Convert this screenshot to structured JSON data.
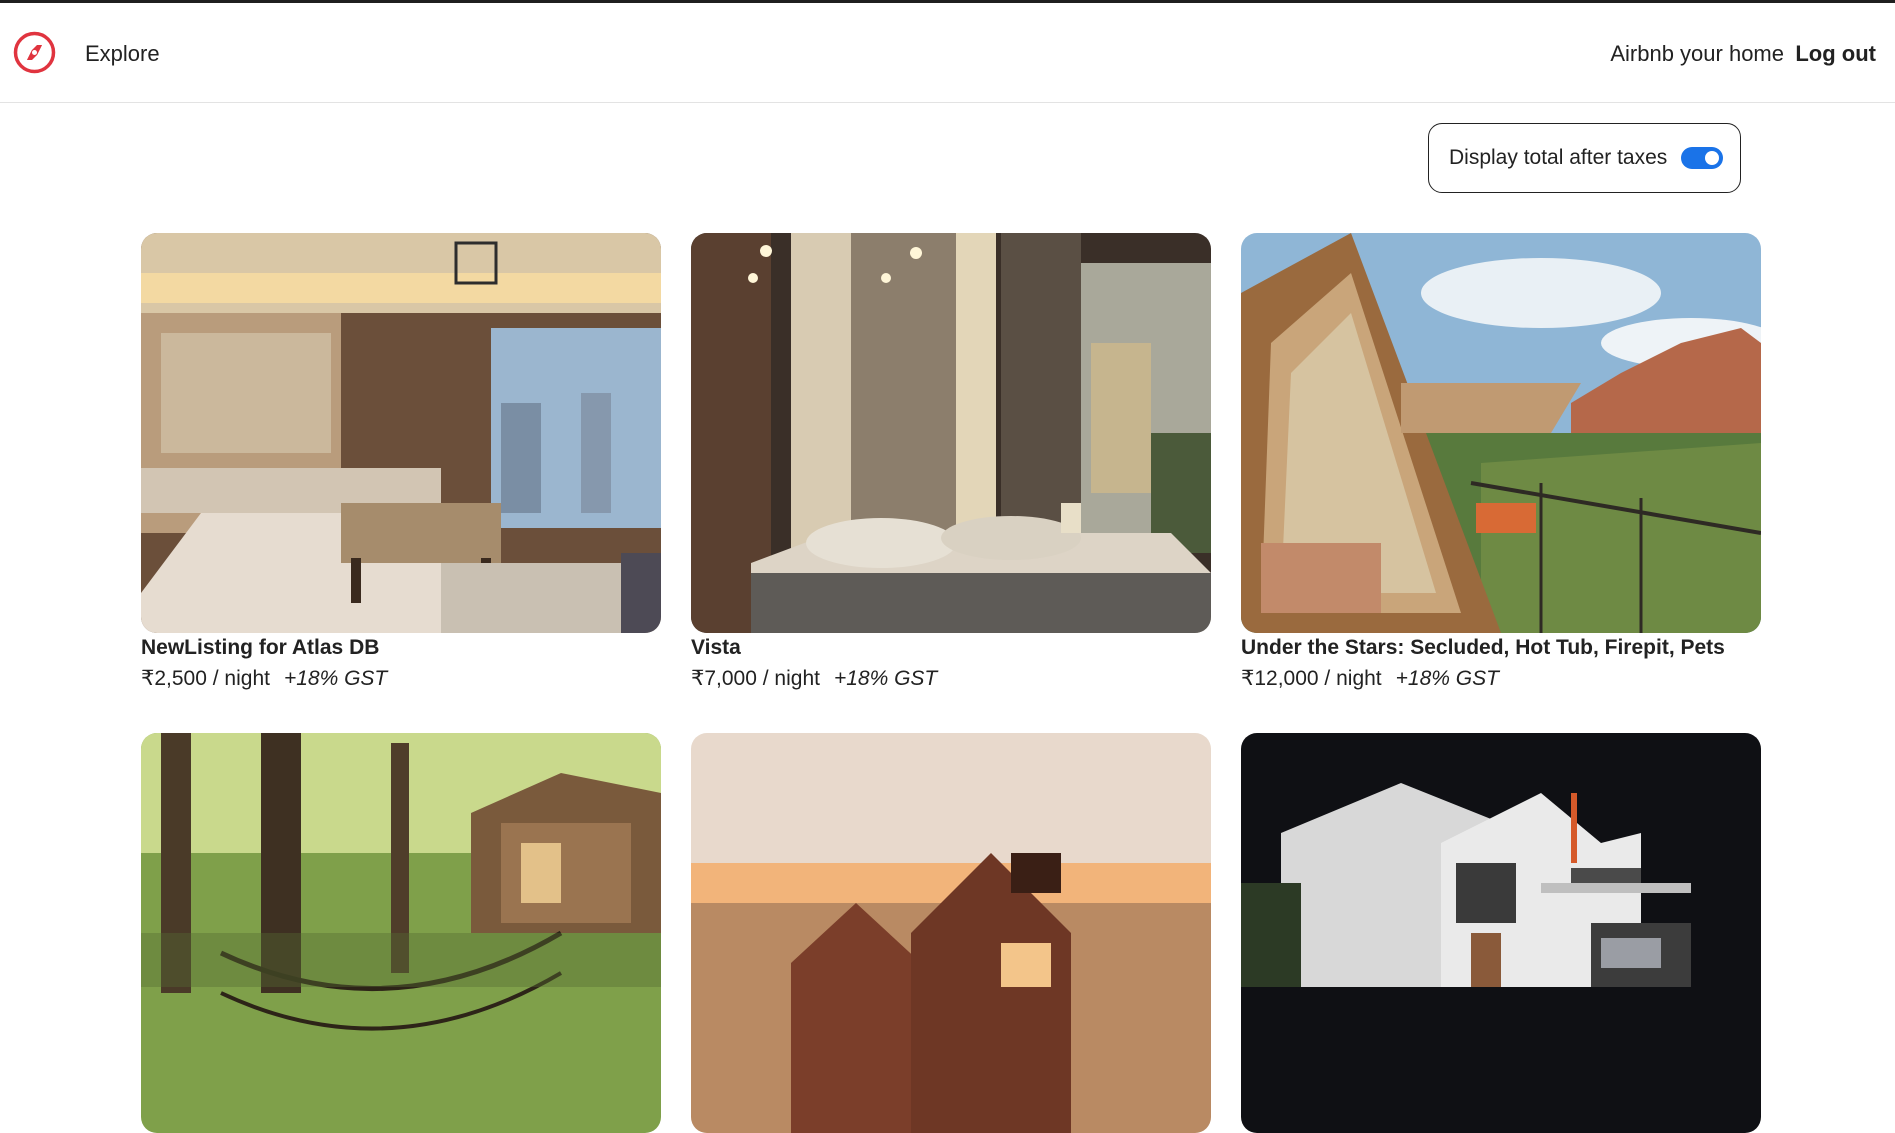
{
  "nav": {
    "explore_label": "Explore",
    "host_label": "Airbnb your home",
    "logout_label": "Log out",
    "brand_color": "#e0343f",
    "logo_icon": "compass-icon"
  },
  "tax_toggle": {
    "label": "Display total after taxes",
    "enabled": true,
    "accent_color": "#1a73e8"
  },
  "listings": [
    {
      "title": "NewListing for Atlas DB",
      "price": "₹2,500 / night",
      "tax_note": "+18% GST",
      "image": "luxury hotel bedroom with city view"
    },
    {
      "title": "Vista",
      "price": "₹7,000 / night",
      "tax_note": "+18% GST",
      "image": "modern bedroom with bed and lamps"
    },
    {
      "title": "Under the Stars: Secluded, Hot Tub, Firepit, Pets",
      "price": "₹12,000 / night",
      "tax_note": "+18% GST",
      "image": "a-frame cabin deck overlooking red canyon"
    },
    {
      "title": "",
      "price": "",
      "tax_note": "",
      "image": "treehouse with rope bridge in forest"
    },
    {
      "title": "",
      "price": "",
      "tax_note": "",
      "image": "two rust-colored gabled cabins at sunset"
    },
    {
      "title": "",
      "price": "",
      "tax_note": "",
      "image": "modern white house lit at night"
    }
  ]
}
